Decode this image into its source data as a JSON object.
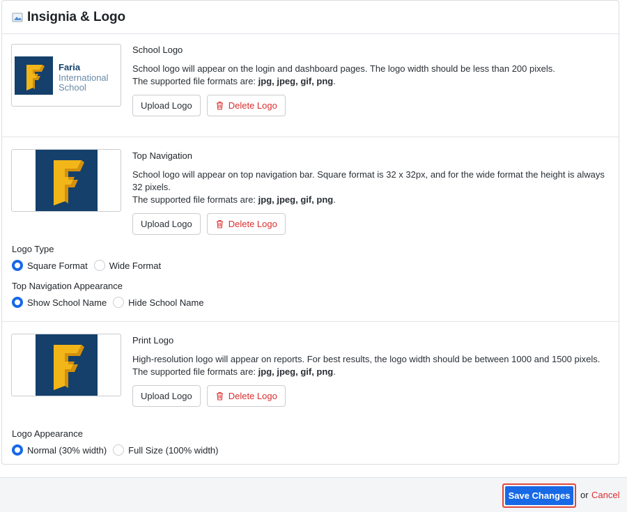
{
  "header": {
    "title": "Insignia & Logo",
    "icon": "image-icon"
  },
  "school_logo": {
    "title": "School Logo",
    "desc": "School logo will appear on the login and dashboard pages. The logo width should be less than 200 pixels.",
    "formats_prefix": "The supported file formats are: ",
    "formats": "jpg, jpeg, gif, png",
    "formats_suffix": ".",
    "upload_label": "Upload Logo",
    "delete_label": "Delete Logo",
    "logo_text": [
      "Faria",
      "International",
      "School"
    ]
  },
  "top_navigation": {
    "title": "Top Navigation",
    "desc": "School logo will appear on top navigation bar. Square format is 32 x 32px, and for the wide format the height is always 32 pixels.",
    "formats_prefix": "The supported file formats are: ",
    "formats": "jpg, jpeg, gif, png",
    "formats_suffix": ".",
    "upload_label": "Upload Logo",
    "delete_label": "Delete Logo",
    "logo_type": {
      "label": "Logo Type",
      "options": [
        "Square Format",
        "Wide Format"
      ],
      "selected": "Square Format"
    },
    "appearance": {
      "label": "Top Navigation Appearance",
      "options": [
        "Show School Name",
        "Hide School Name"
      ],
      "selected": "Show School Name"
    }
  },
  "print_logo": {
    "title": "Print Logo",
    "desc": "High-resolution logo will appear on reports. For best results, the logo width should be between 1000 and 1500 pixels.",
    "formats_prefix": "The supported file formats are: ",
    "formats": "jpg, jpeg, gif, png",
    "formats_suffix": ".",
    "upload_label": "Upload Logo",
    "delete_label": "Delete Logo",
    "appearance": {
      "label": "Logo Appearance",
      "options": [
        "Normal (30% width)",
        "Full Size (100% width)"
      ],
      "selected": "Normal (30% width)"
    }
  },
  "footer": {
    "save_label": "Save Changes",
    "or_text": "or",
    "cancel_label": "Cancel"
  },
  "colors": {
    "accent": "#1769e6",
    "danger": "#d92d2d",
    "logo_bg": "#14406b",
    "logo_gold": "#f2b619"
  }
}
